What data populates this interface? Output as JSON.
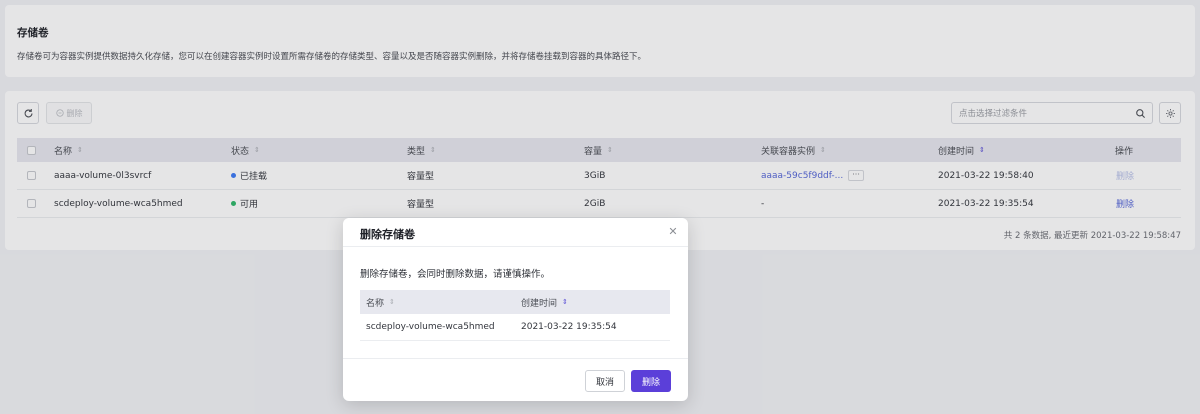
{
  "header": {
    "title": "存储卷",
    "description": "存储卷可为容器实例提供数据持久化存储，您可以在创建容器实例时设置所需存储卷的存储类型、容量以及是否随容器实例删除，并将存储卷挂载到容器的具体路径下。"
  },
  "toolbar": {
    "refresh_icon": "refresh-icon",
    "delete_label": "删除",
    "filter_placeholder": "点击选择过滤条件",
    "search_icon": "search-icon",
    "settings_icon": "gear-icon"
  },
  "table": {
    "columns": {
      "name": "名称",
      "status": "状态",
      "type": "类型",
      "capacity": "容量",
      "instance": "关联容器实例",
      "created": "创建时间",
      "action": "操作"
    },
    "rows": [
      {
        "name": "aaaa-volume-0l3svrcf",
        "status": "已挂载",
        "status_color": "#3d7af5",
        "type": "容量型",
        "capacity": "3GiB",
        "instance": "aaaa-59c5f9ddf-...",
        "more": "···",
        "created": "2021-03-22 19:58:40",
        "action": "删除"
      },
      {
        "name": "scdeploy-volume-wca5hmed",
        "status": "可用",
        "status_color": "#2fb86a",
        "type": "容量型",
        "capacity": "2GiB",
        "instance": "-",
        "created": "2021-03-22 19:35:54",
        "action": "删除"
      }
    ],
    "footer": "共 2 条数据,   最近更新   2021-03-22 19:58:47"
  },
  "modal": {
    "title": "删除存储卷",
    "close_icon": "close-icon",
    "message": "删除存储卷，会同时删除数据，请谨慎操作。",
    "columns": {
      "name": "名称",
      "created": "创建时间"
    },
    "rows": [
      {
        "name": "scdeploy-volume-wca5hmed",
        "created": "2021-03-22 19:35:54"
      }
    ],
    "cancel_label": "取消",
    "confirm_label": "删除"
  },
  "colors": {
    "accent": "#5b3fd9",
    "link": "#5667d8"
  }
}
